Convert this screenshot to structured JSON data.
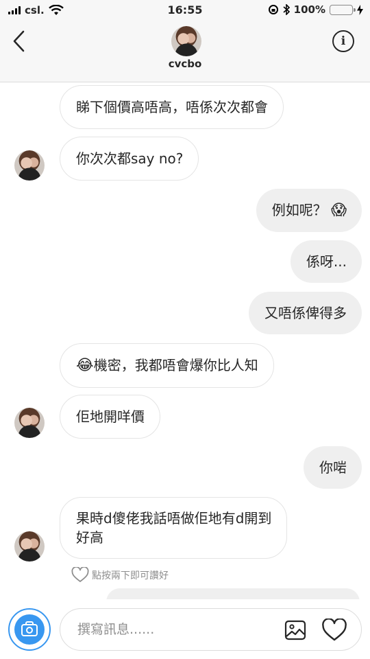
{
  "status_bar": {
    "carrier": "csl.",
    "time": "16:55",
    "battery": "100%",
    "battery_level": 1.0
  },
  "header": {
    "username": "cvcbo",
    "back_icon": "chevron-left-icon",
    "info_icon": "info-icon"
  },
  "messages": [
    {
      "side": "in",
      "text": "睇下個價高唔高，唔係次次都會"
    },
    {
      "side": "in",
      "text": "你次次都say no?"
    },
    {
      "side": "out",
      "text": "例如呢？",
      "emoji": "😱"
    },
    {
      "side": "out",
      "text": "係呀..."
    },
    {
      "side": "out",
      "text": "又唔係俾得多"
    },
    {
      "side": "in",
      "emoji": "😂",
      "text": "機密，我都唔會爆你比人知"
    },
    {
      "side": "in",
      "text": "佢地開咩價"
    },
    {
      "side": "out",
      "text": "你啱"
    },
    {
      "side": "in",
      "text_line1": "果時d傻佬我話唔做佢地有d開到",
      "text_line2": "好高"
    }
  ],
  "like_hint": "點按兩下即可讚好",
  "composer": {
    "placeholder": "撰寫訊息......",
    "camera_icon": "camera-icon",
    "gallery_icon": "gallery-icon",
    "heart_icon": "heart-icon"
  },
  "colors": {
    "accent": "#3897f0",
    "battery_green": "#4cd964",
    "outgoing_bubble": "#efefef",
    "incoming_border": "#e4e4e4"
  }
}
